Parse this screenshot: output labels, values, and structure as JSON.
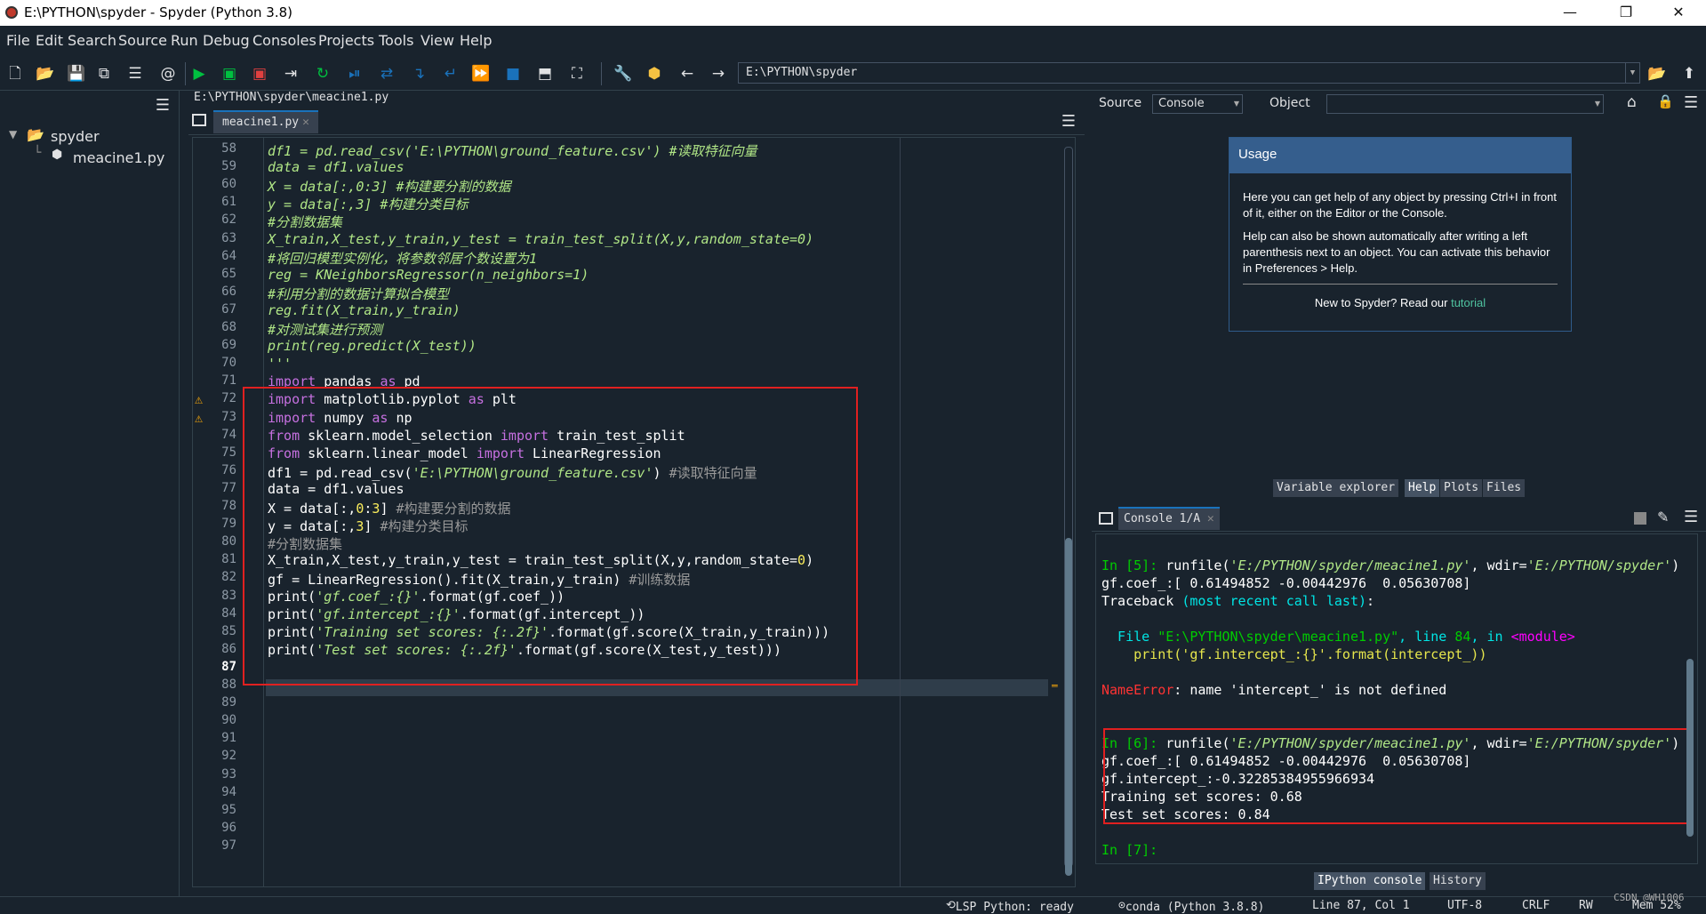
{
  "window": {
    "title": "E:\\PYTHON\\spyder - Spyder (Python 3.8)",
    "minimize": "—",
    "maximize": "❐",
    "close": "✕"
  },
  "menu": [
    "File",
    "Edit",
    "Search",
    "Source",
    "Run",
    "Debug",
    "Consoles",
    "Projects",
    "Tools",
    "View",
    "Help"
  ],
  "toolbar": {
    "path": "E:\\PYTHON\\spyder"
  },
  "files": {
    "root": "spyder",
    "file": "meacine1.py"
  },
  "editor": {
    "path": "E:\\PYTHON\\spyder\\meacine1.py",
    "tab": "meacine1.py",
    "tab_close": "✕",
    "line_numbers": [
      "58",
      "59",
      "60",
      "61",
      "62",
      "63",
      "64",
      "65",
      "66",
      "67",
      "68",
      "69",
      "70",
      "71",
      "72",
      "73",
      "74",
      "75",
      "76",
      "77",
      "78",
      "79",
      "80",
      "81",
      "82",
      "83",
      "84",
      "85",
      "86",
      "87",
      "88",
      "89",
      "90",
      "91",
      "92",
      "93",
      "94",
      "95",
      "96",
      "97"
    ],
    "current_line": "87",
    "warnings": [
      "⚠",
      "⚠"
    ],
    "lines": {
      "l58a": "df1 = pd.read_csv('E:\\PYTHON\\ground_feature.csv') #读取特征向量",
      "l59a": "data = df1.values",
      "l60a": "X = data[:,0:3] #构建要分割的数据",
      "l61a": "y = data[:,3] #构建分类目标",
      "l62a": "#分割数据集",
      "l63a": "X_train,X_test,y_train,y_test = train_test_split(X,y,random_state=0)",
      "l64a": "#将回归模型实例化，将参数邻居个数设置为1",
      "l65a": "reg = KNeighborsRegressor(n_neighbors=1)",
      "l66a": "#利用分割的数据计算拟合模型",
      "l67a": "reg.fit(X_train,y_train)",
      "l68a": "#对测试集进行预测",
      "l69a": "print(reg.predict(X_test))",
      "l70a": "'''",
      "l71a": "import",
      "l71b": " pandas ",
      "l71c": "as",
      "l71d": " pd",
      "l72a": "import",
      "l72b": " matplotlib.pyplot ",
      "l72c": "as",
      "l72d": " plt",
      "l73a": "import",
      "l73b": " numpy ",
      "l73c": "as",
      "l73d": " np",
      "l74a": "from",
      "l74b": " sklearn.model_selection ",
      "l74c": "import",
      "l74d": " train_test_split",
      "l75a": "from",
      "l75b": " sklearn.linear_model ",
      "l75c": "import",
      "l75d": " LinearRegression",
      "l76a": "df1 = pd.read_csv(",
      "l76b": "'E:\\PYTHON\\ground_feature.csv'",
      "l76c": ") ",
      "l76d": "#读取特征向量",
      "l77a": "data = df1.values",
      "l78a": "X = data[:,",
      "l78b": "0",
      "l78c": ":",
      "l78d": "3",
      "l78e": "] ",
      "l78f": "#构建要分割的数据",
      "l79a": "y = data[:,",
      "l79b": "3",
      "l79c": "] ",
      "l79d": "#构建分类目标",
      "l80a": "#分割数据集",
      "l81a": "X_train,X_test,y_train,y_test = train_test_split(X,y,random_state=",
      "l81b": "0",
      "l81c": ")",
      "l82a": "gf = LinearRegression().fit(X_train,y_train) ",
      "l82b": "#训练数据",
      "l83a": "print(",
      "l83b": "'gf.coef_:{}'",
      "l83c": ".format(gf.coef_))",
      "l84a": "print(",
      "l84b": "'gf.intercept_:{}'",
      "l84c": ".format(gf.intercept_))",
      "l85a": "print(",
      "l85b": "'Training set scores: {:.2f}'",
      "l85c": ".format(gf.score(X_train,y_train)))",
      "l86a": "print(",
      "l86b": "'Test set scores: {:.2f}'",
      "l86c": ".format(gf.score(X_test,y_test)))"
    }
  },
  "help": {
    "source_label": "Source",
    "source_value": "Console",
    "object_label": "Object",
    "object_value": "",
    "usage_title": "Usage",
    "p1": "Here you can get help of any object by pressing Ctrl+I in front of it, either on the Editor or the Console.",
    "p2": "Help can also be shown automatically after writing a left parenthesis next to an object. You can activate this behavior in Preferences > Help.",
    "p3_prefix": "New to Spyder? Read our ",
    "p3_link": "tutorial",
    "tabs": [
      "Variable explorer",
      "Help",
      "Plots",
      "Files"
    ]
  },
  "console": {
    "tab": "Console 1/A",
    "tab_close": "✕",
    "l1a": "In [",
    "l1b": "5",
    "l1c": "]: ",
    "l1d": "runfile(",
    "l1e": "'E:/PYTHON/spyder/meacine1.py'",
    "l1f": ", wdir=",
    "l1g": "'E:/PYTHON/spyder'",
    "l1h": ")",
    "l2": "gf.coef_:[ 0.61494852 -0.00442976  0.05630708]",
    "l3a": "Traceback ",
    "l3b": "(most recent call last)",
    "l3c": ":",
    "l4a": "  File ",
    "l4b": "\"E:\\PYTHON\\spyder\\meacine1.py\"",
    "l4c": ", line ",
    "l4d": "84",
    "l4e": ", in ",
    "l4f": "<module>",
    "l5": "    print('gf.intercept_:{}'.format(intercept_))",
    "l6a": "NameError",
    "l6b": ": name 'intercept_' is not defined",
    "l7a": "In [",
    "l7b": "6",
    "l7c": "]: ",
    "l7d": "runfile(",
    "l7e": "'E:/PYTHON/spyder/meacine1.py'",
    "l7f": ", wdir=",
    "l7g": "'E:/PYTHON/spyder'",
    "l7h": ")",
    "l8": "gf.coef_:[ 0.61494852 -0.00442976  0.05630708]",
    "l9": "gf.intercept_:-0.32285384955966934",
    "l10": "Training set scores: 0.68",
    "l11": "Test set scores: 0.84",
    "l12a": "In [",
    "l12b": "7",
    "l12c": "]:",
    "tabs": [
      "IPython console",
      "History"
    ]
  },
  "status": {
    "lsp": "LSP Python: ready",
    "conda": "conda (Python 3.8.8)",
    "pos": "Line 87, Col 1",
    "enc": "UTF-8",
    "eol": "CRLF",
    "rw": "RW",
    "mem": "Mem 52%",
    "watermark": "CSDN @WH1006"
  },
  "colors": {
    "background": "#19232d",
    "accent": "#1a72bb",
    "highlight_box": "#e02020",
    "usage_header": "#355e8d"
  }
}
